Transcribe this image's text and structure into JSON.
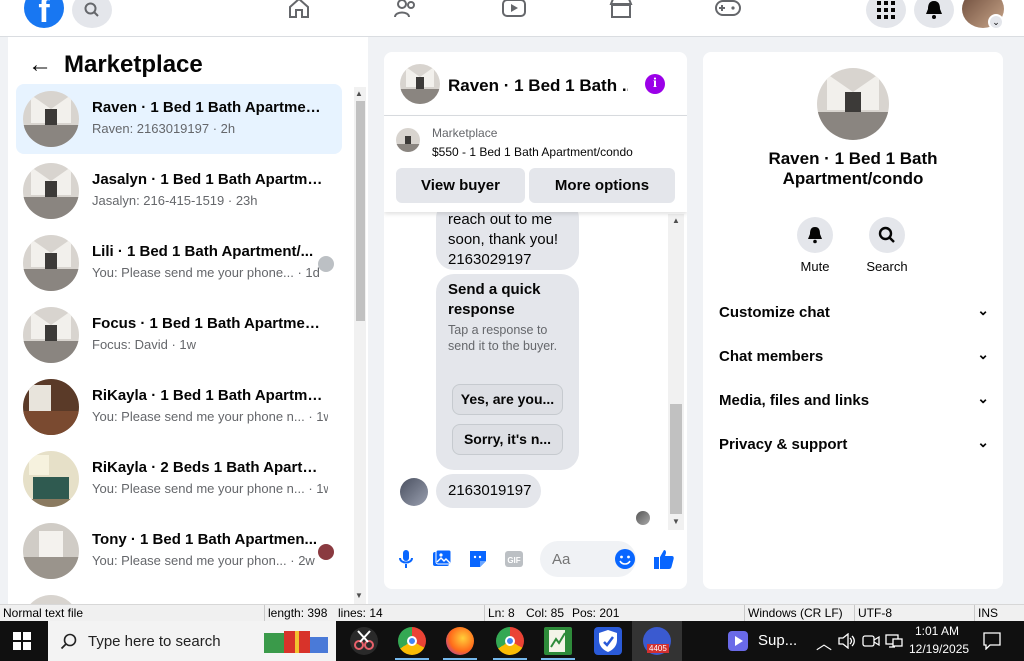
{
  "topnav": {
    "logo_letter": "f"
  },
  "sidebar": {
    "title": "Marketplace",
    "conversations": [
      {
        "title": "Raven · 1 Bed 1 Bath Apartment/...",
        "subtitle": "Raven: 2163019197 · 2h",
        "active": true
      },
      {
        "title": "Jasalyn · 1 Bed 1 Bath Apartmen...",
        "subtitle": "Jasalyn: 216-415-1519 · 23h"
      },
      {
        "title": "Lili · 1 Bed 1 Bath Apartment/...",
        "subtitle": "You: Please send me your phone... · 1d"
      },
      {
        "title": "Focus · 1 Bed 1 Bath Apartment/...",
        "subtitle": "Focus: David · 1w"
      },
      {
        "title": "RiKayla · 1 Bed 1 Bath Apartmen...",
        "subtitle": "You: Please send me your phone n... · 1w"
      },
      {
        "title": "RiKayla · 2 Beds 1 Bath Apartme...",
        "subtitle": "You: Please send me your phone n... · 1w"
      },
      {
        "title": "Tony · 1 Bed 1 Bath Apartmen...",
        "subtitle": "You: Please send me your phon... · 2w"
      }
    ]
  },
  "chat": {
    "title": "Raven · 1 Bed 1 Bath ...",
    "listing_label": "Marketplace",
    "listing_price": "$550 - 1 Bed 1 Bath Apartment/condo",
    "view_buyer": "View buyer",
    "more_options": "More options",
    "message1": "reach out to me soon, thank you! 2163029197",
    "quick_title": "Send a quick response",
    "quick_sub": "Tap a response to send it to the buyer.",
    "quick_replies": [
      "Yes, are you...",
      "Sorry, it's n..."
    ],
    "message2": "2163019197",
    "input_placeholder": "Aa"
  },
  "info_panel": {
    "title": "Raven · 1 Bed 1 Bath Apartment/condo",
    "mute_label": "Mute",
    "search_label": "Search",
    "sections": [
      "Customize chat",
      "Chat members",
      "Media, files and links",
      "Privacy & support"
    ]
  },
  "status_bar": {
    "mode": "Normal text file",
    "length": "length: 398",
    "lines": "lines: 14",
    "ln": "Ln: 8",
    "col": "Col: 85",
    "pos": "Pos: 201",
    "eol": "Windows (CR LF)",
    "encoding": "UTF-8",
    "ins": "INS"
  },
  "taskbar": {
    "search_placeholder": "Type here to search",
    "badge": "4405",
    "sup_label": "Sup...",
    "time": "1:01 AM",
    "date": "12/19/2025"
  },
  "colors": {
    "accent": "#1877f2",
    "info": "#9b00e8",
    "active_row": "#e7f3ff"
  }
}
